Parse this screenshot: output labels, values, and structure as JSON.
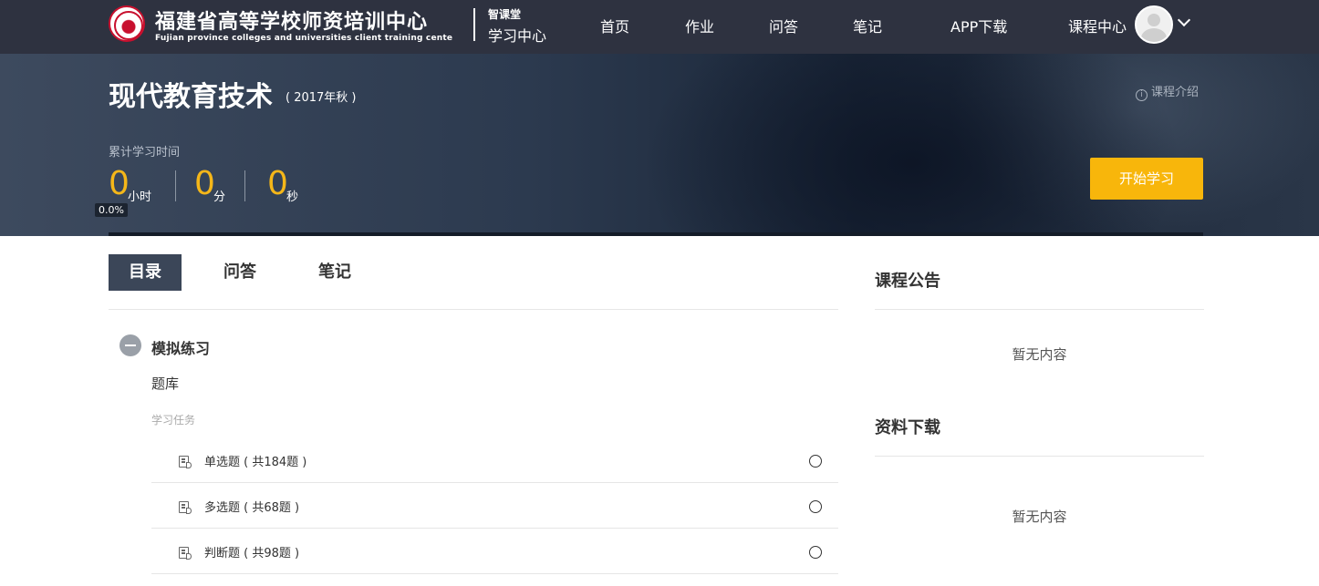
{
  "header": {
    "logo_cn": "福建省高等学校师资培训中心",
    "logo_en": "Fujian province colleges and universities client training cente",
    "brand_small": "智课堂",
    "brand_big": "学习中心",
    "nav": [
      {
        "label": "首页"
      },
      {
        "label": "作业"
      },
      {
        "label": "问答"
      },
      {
        "label": "笔记"
      },
      {
        "label": "APP下载"
      },
      {
        "label": "课程中心"
      }
    ]
  },
  "course": {
    "title": "现代教育技术",
    "term": "( 2017年秋 )",
    "intro_link": "课程介绍",
    "study_time_label": "累计学习时间",
    "hours": "0",
    "hours_unit": "小时",
    "minutes": "0",
    "minutes_unit": "分",
    "seconds": "0",
    "seconds_unit": "秒",
    "progress_text": "0.0%",
    "progress_value": 0.0,
    "start_button": "开始学习"
  },
  "tabs": [
    {
      "label": "目录",
      "active": true
    },
    {
      "label": "问答",
      "active": false
    },
    {
      "label": "笔记",
      "active": false
    }
  ],
  "catalog": {
    "chapter_title": "模拟练习",
    "section_title": "题库",
    "task_label": "学习任务",
    "tasks": [
      {
        "name": "单选题 ( 共184题 )"
      },
      {
        "name": "多选题 ( 共68题 )"
      },
      {
        "name": "判断题 ( 共98题 )"
      }
    ]
  },
  "sidebar": {
    "announcement_title": "课程公告",
    "announcement_empty": "暂无内容",
    "download_title": "资料下载",
    "download_empty": "暂无内容"
  },
  "colors": {
    "nav_bg": "#2e3240",
    "accent": "#f8b60b",
    "time_number": "#f5b719",
    "active_tab": "#3b4658"
  }
}
